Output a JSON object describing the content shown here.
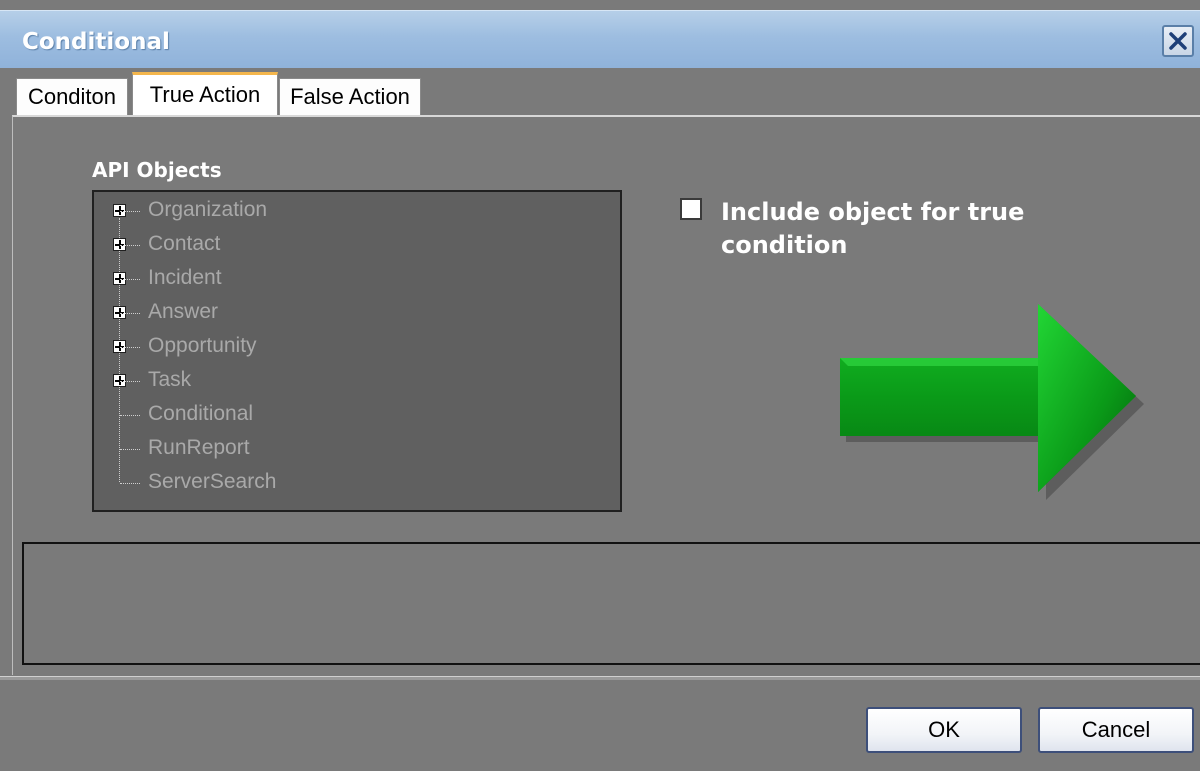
{
  "window": {
    "title": "Conditional"
  },
  "tabs": [
    {
      "label": "Conditon",
      "active": false
    },
    {
      "label": "True Action",
      "active": true
    },
    {
      "label": "False Action",
      "active": false
    }
  ],
  "api_objects": {
    "label": "API Objects",
    "items": [
      {
        "label": "Organization",
        "expandable": true
      },
      {
        "label": "Contact",
        "expandable": true
      },
      {
        "label": "Incident",
        "expandable": true
      },
      {
        "label": "Answer",
        "expandable": true
      },
      {
        "label": "Opportunity",
        "expandable": true
      },
      {
        "label": "Task",
        "expandable": true
      },
      {
        "label": "Conditional",
        "expandable": false
      },
      {
        "label": "RunReport",
        "expandable": false
      },
      {
        "label": "ServerSearch",
        "expandable": false
      }
    ]
  },
  "include_checkbox": {
    "label": "Include object for true condition",
    "checked": false
  },
  "icons": {
    "arrow": "green-right-arrow-icon",
    "close": "close-icon"
  },
  "colors": {
    "arrow": "#0a9a18",
    "titlebar": "#9dbde0",
    "tab_active_accent": "#f4b64c"
  },
  "buttons": {
    "ok_label": "OK",
    "cancel_label": "Cancel"
  }
}
